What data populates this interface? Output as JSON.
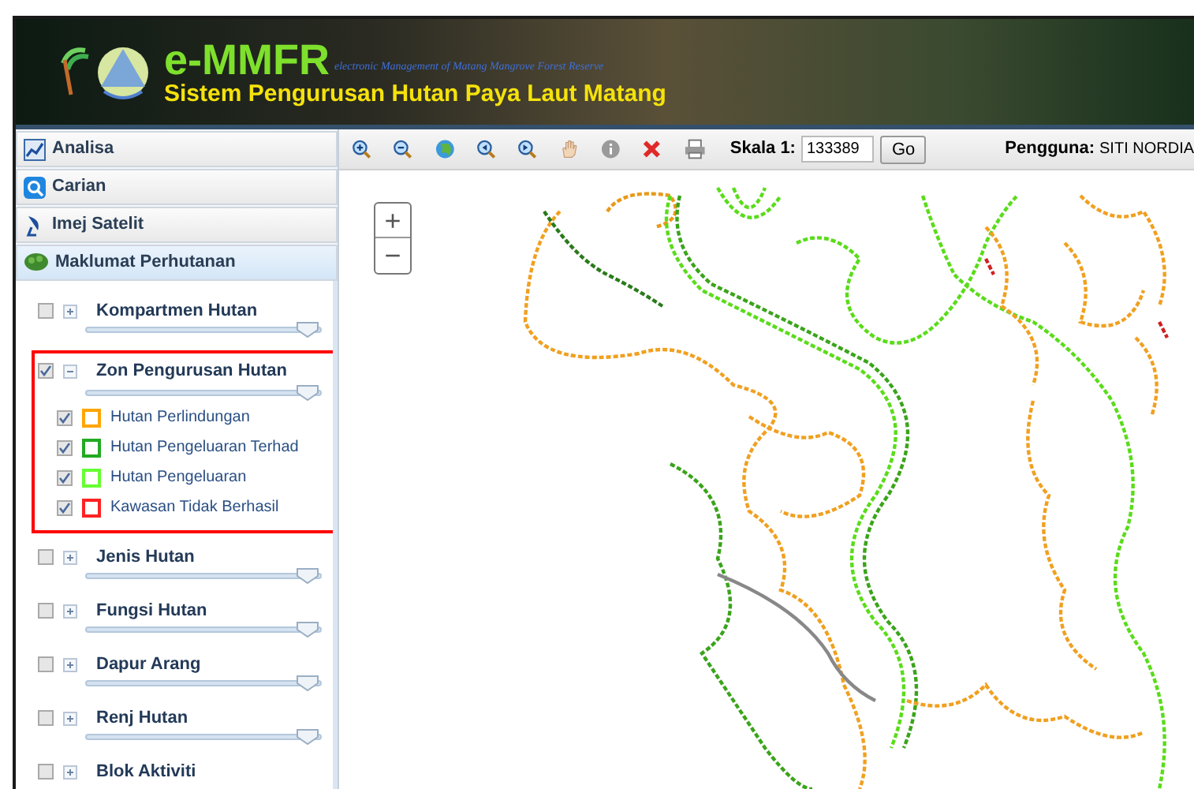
{
  "header": {
    "title": "e-MMFR",
    "subtitle": "electronic Management of Matang Mangrove Forest Reserve",
    "tagline": "Sistem Pengurusan Hutan Paya Laut Matang"
  },
  "sidebar": {
    "panels": [
      {
        "label": "Analisa",
        "kind": "chart",
        "expanded": false
      },
      {
        "label": "Carian",
        "kind": "search",
        "expanded": false
      },
      {
        "label": "Imej Satelit",
        "kind": "satellite",
        "expanded": false
      },
      {
        "label": "Maklumat Perhutanan",
        "kind": "tree",
        "expanded": true
      }
    ],
    "layers": [
      {
        "label": "Kompartmen Hutan",
        "checked": false,
        "expanded": false,
        "highlighted": false,
        "level": 0.96
      },
      {
        "label": "Zon Pengurusan Hutan",
        "checked": true,
        "expanded": true,
        "highlighted": true,
        "level": 0.96,
        "children": [
          {
            "label": "Hutan Perlindungan",
            "checked": true,
            "color": "#ffa500"
          },
          {
            "label": "Hutan Pengeluaran Terhad",
            "checked": true,
            "color": "#22aa22"
          },
          {
            "label": "Hutan Pengeluaran",
            "checked": true,
            "color": "#66ff33"
          },
          {
            "label": "Kawasan Tidak Berhasil",
            "checked": true,
            "color": "#ff2222"
          }
        ]
      },
      {
        "label": "Jenis Hutan",
        "checked": false,
        "expanded": false,
        "highlighted": false,
        "level": 0.96
      },
      {
        "label": "Fungsi Hutan",
        "checked": false,
        "expanded": false,
        "highlighted": false,
        "level": 0.96
      },
      {
        "label": "Dapur Arang",
        "checked": false,
        "expanded": false,
        "highlighted": false,
        "level": 0.96
      },
      {
        "label": "Renj Hutan",
        "checked": false,
        "expanded": false,
        "highlighted": false,
        "level": 0.96
      },
      {
        "label": "Blok Aktiviti",
        "checked": false,
        "expanded": false,
        "highlighted": false
      }
    ]
  },
  "toolbar": {
    "scale_label": "Skala 1:",
    "scale_value": "133389",
    "go_button": "Go",
    "user_label": "Pengguna:",
    "user_name": "SITI NORDIA"
  },
  "map": {
    "zoom_in": "+",
    "zoom_out": "−"
  }
}
